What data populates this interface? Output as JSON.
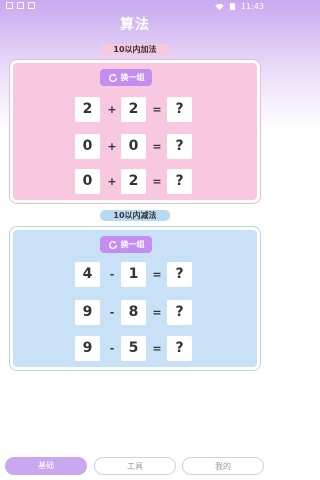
{
  "status_bar": {
    "time": "11:43"
  },
  "header": {
    "title": "算法"
  },
  "addition": {
    "label": "10以内加法",
    "refresh_label": "换一组",
    "rows": [
      {
        "a": "2",
        "op": "+",
        "b": "2",
        "eq": "=",
        "answer": "?"
      },
      {
        "a": "0",
        "op": "+",
        "b": "0",
        "eq": "=",
        "answer": "?"
      },
      {
        "a": "0",
        "op": "+",
        "b": "2",
        "eq": "=",
        "answer": "?"
      }
    ]
  },
  "subtraction": {
    "label": "10以内减法",
    "refresh_label": "换一组",
    "rows": [
      {
        "a": "4",
        "op": "-",
        "b": "1",
        "eq": "=",
        "answer": "?"
      },
      {
        "a": "9",
        "op": "-",
        "b": "8",
        "eq": "=",
        "answer": "?"
      },
      {
        "a": "9",
        "op": "-",
        "b": "5",
        "eq": "=",
        "answer": "?"
      }
    ]
  },
  "bottom_nav": {
    "items": [
      "基础",
      "工具",
      "我的"
    ]
  },
  "colors": {
    "accent": "#c9a8f0",
    "addition_bg": "#f7c8df",
    "subtraction_bg": "#c9e1f6",
    "refresh_button": "#c48df0"
  },
  "icons": {
    "refresh": "refresh-icon",
    "wifi": "wifi-icon",
    "battery": "battery-icon"
  }
}
